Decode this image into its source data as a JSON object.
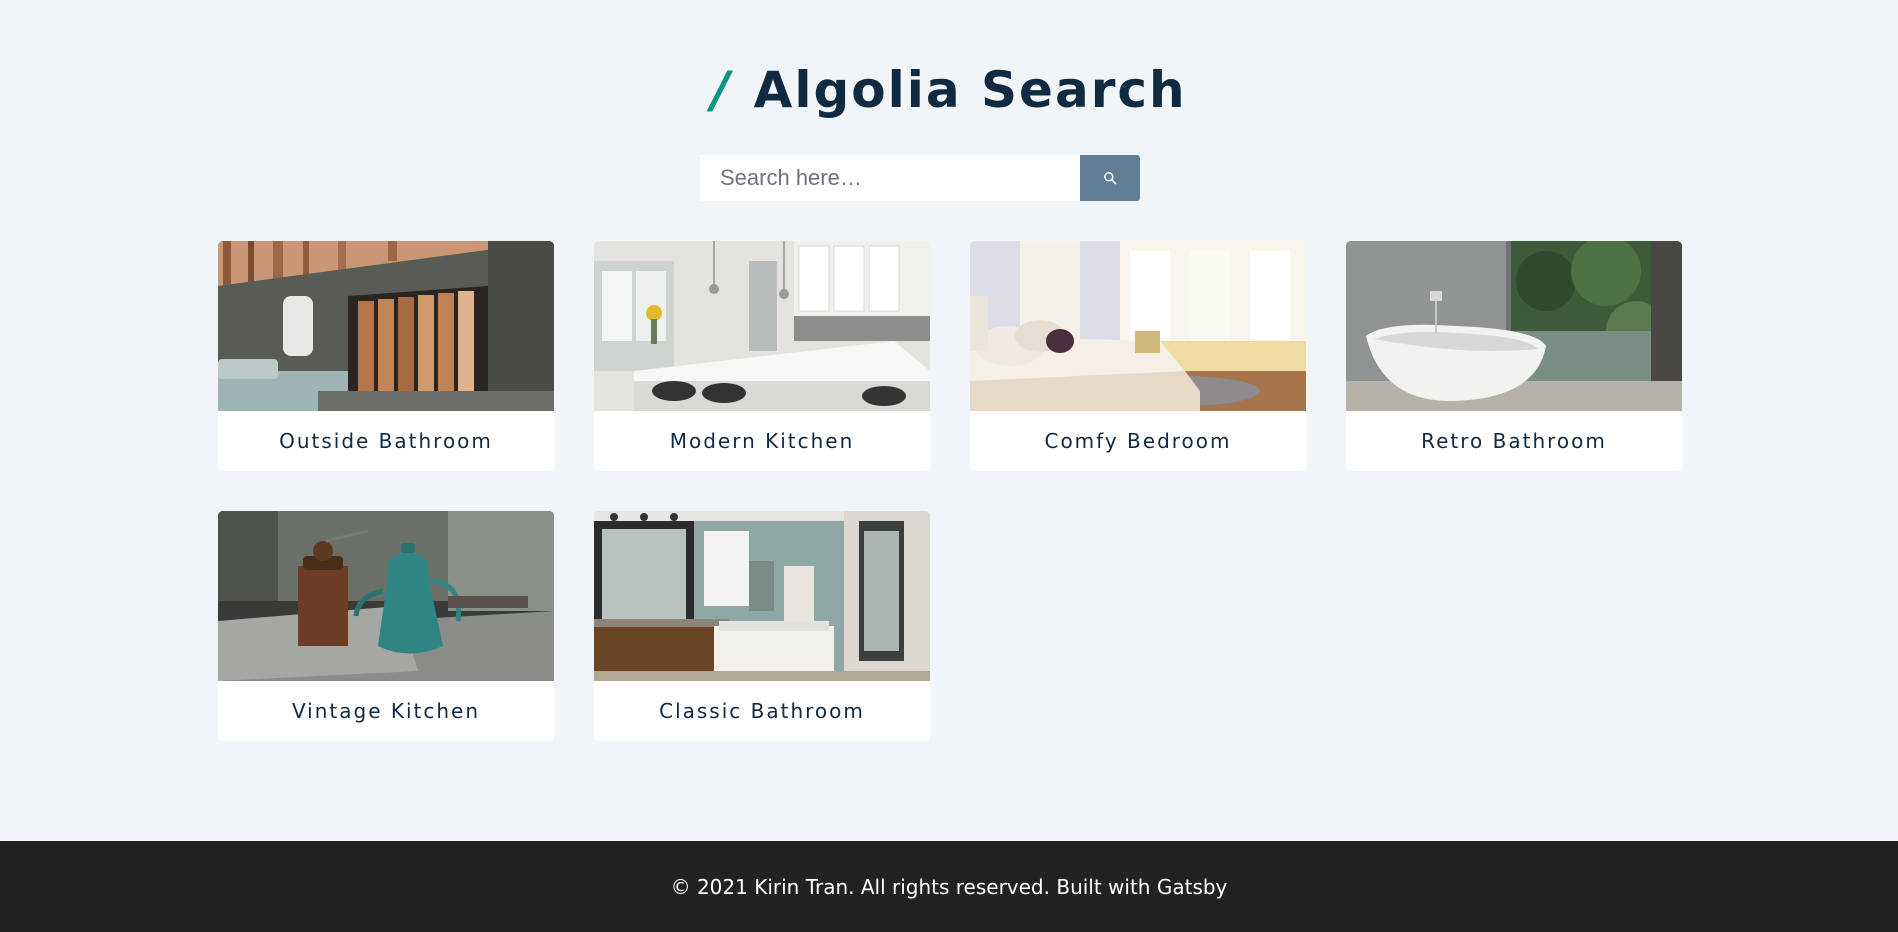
{
  "header": {
    "slash": "/",
    "title": "Algolia Search"
  },
  "search": {
    "placeholder": "Search here…",
    "value": "",
    "button_icon": "search-icon"
  },
  "colors": {
    "accent": "#0d9488",
    "button": "#617d98",
    "text": "#102a42",
    "background": "#f1f5f8",
    "footer": "#222222"
  },
  "cards": [
    {
      "title": "Outside Bathroom"
    },
    {
      "title": "Modern Kitchen"
    },
    {
      "title": "Comfy Bedroom"
    },
    {
      "title": "Retro Bathroom"
    },
    {
      "title": "Vintage Kitchen"
    },
    {
      "title": "Classic Bathroom"
    }
  ],
  "footer": {
    "text": "© 2021 Kirin Tran. All rights reserved. Built with Gatsby"
  }
}
